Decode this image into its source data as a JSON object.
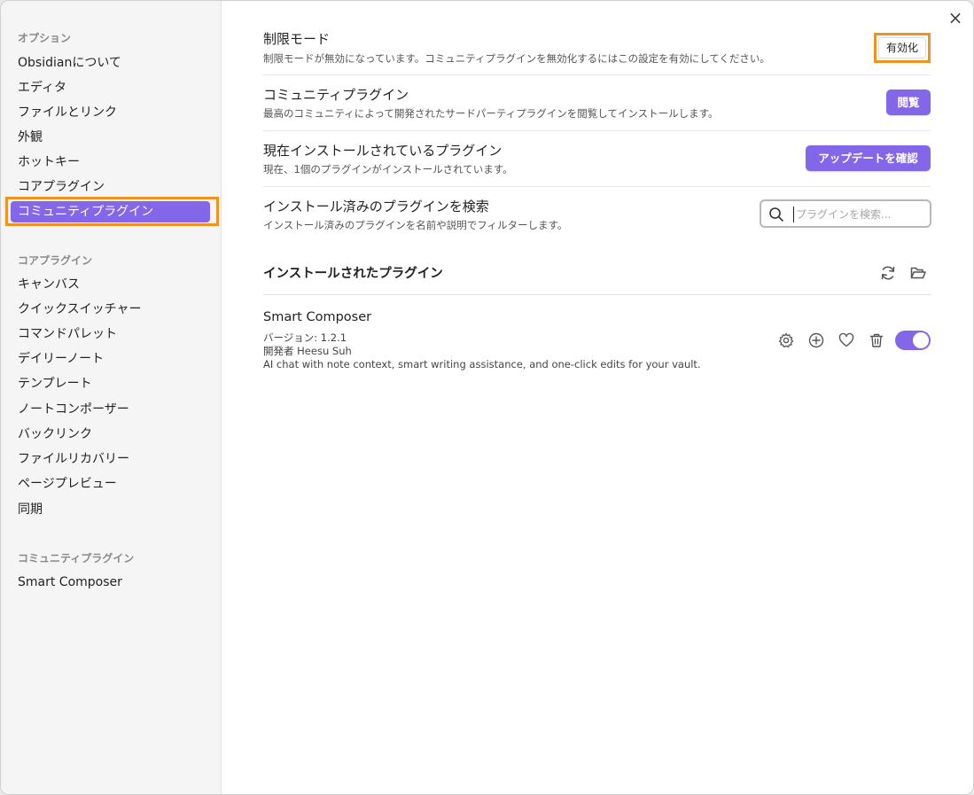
{
  "sidebar": {
    "options_heading": "オプション",
    "options_items": [
      "Obsidianについて",
      "エディタ",
      "ファイルとリンク",
      "外観",
      "ホットキー",
      "コアプラグイン"
    ],
    "active_item": "コミュニティプラグイン",
    "core_heading": "コアプラグイン",
    "core_items": [
      "キャンバス",
      "クイックスイッチャー",
      "コマンドパレット",
      "デイリーノート",
      "テンプレート",
      "ノートコンポーザー",
      "バックリンク",
      "ファイルリカバリー",
      "ページプレビュー",
      "同期"
    ],
    "community_heading": "コミュニティプラグイン",
    "community_items": [
      "Smart Composer"
    ]
  },
  "main": {
    "close_icon": "×",
    "restricted": {
      "title": "制限モード",
      "desc": "制限モードが無効になっています。コミュニティプラグインを無効化するにはこの設定を有効にしてください。",
      "button": "有効化"
    },
    "community": {
      "title": "コミュニティプラグイン",
      "desc": "最高のコミュニティによって開発されたサードパーティプラグインを閲覧してインストールします。",
      "button": "閲覧"
    },
    "installed_now": {
      "title": "現在インストールされているプラグイン",
      "desc": "現在、1個のプラグインがインストールされています。",
      "button": "アップデートを確認"
    },
    "search": {
      "title": "インストール済みのプラグインを検索",
      "desc": "インストール済みのプラグインを名前や説明でフィルターします。",
      "placeholder": "プラグインを検索..."
    },
    "installed_section": {
      "title": "インストールされたプラグイン"
    },
    "plugin": {
      "name": "Smart Composer",
      "version": "バージョン: 1.2.1",
      "author": "開発者 Heesu Suh",
      "description": "AI chat with note context, smart writing assistance, and one-click edits for your vault.",
      "enabled": true
    }
  },
  "colors": {
    "accent": "#8467e8",
    "highlight": "#f0931e"
  }
}
